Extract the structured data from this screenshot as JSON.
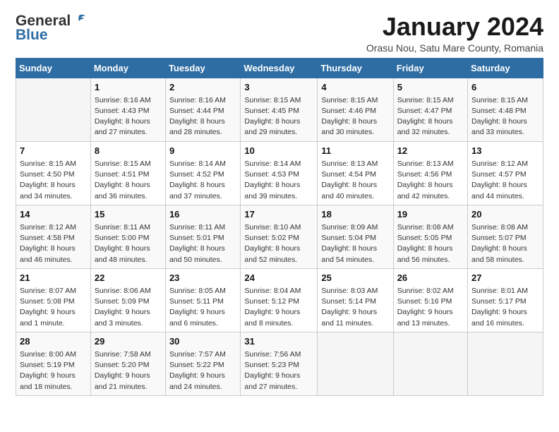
{
  "header": {
    "logo_general": "General",
    "logo_blue": "Blue",
    "title": "January 2024",
    "subtitle": "Orasu Nou, Satu Mare County, Romania"
  },
  "days_of_week": [
    "Sunday",
    "Monday",
    "Tuesday",
    "Wednesday",
    "Thursday",
    "Friday",
    "Saturday"
  ],
  "weeks": [
    [
      {
        "day": "",
        "sunrise": "",
        "sunset": "",
        "daylight": ""
      },
      {
        "day": "1",
        "sunrise": "Sunrise: 8:16 AM",
        "sunset": "Sunset: 4:43 PM",
        "daylight": "Daylight: 8 hours and 27 minutes."
      },
      {
        "day": "2",
        "sunrise": "Sunrise: 8:16 AM",
        "sunset": "Sunset: 4:44 PM",
        "daylight": "Daylight: 8 hours and 28 minutes."
      },
      {
        "day": "3",
        "sunrise": "Sunrise: 8:15 AM",
        "sunset": "Sunset: 4:45 PM",
        "daylight": "Daylight: 8 hours and 29 minutes."
      },
      {
        "day": "4",
        "sunrise": "Sunrise: 8:15 AM",
        "sunset": "Sunset: 4:46 PM",
        "daylight": "Daylight: 8 hours and 30 minutes."
      },
      {
        "day": "5",
        "sunrise": "Sunrise: 8:15 AM",
        "sunset": "Sunset: 4:47 PM",
        "daylight": "Daylight: 8 hours and 32 minutes."
      },
      {
        "day": "6",
        "sunrise": "Sunrise: 8:15 AM",
        "sunset": "Sunset: 4:48 PM",
        "daylight": "Daylight: 8 hours and 33 minutes."
      }
    ],
    [
      {
        "day": "7",
        "sunrise": "Sunrise: 8:15 AM",
        "sunset": "Sunset: 4:50 PM",
        "daylight": "Daylight: 8 hours and 34 minutes."
      },
      {
        "day": "8",
        "sunrise": "Sunrise: 8:15 AM",
        "sunset": "Sunset: 4:51 PM",
        "daylight": "Daylight: 8 hours and 36 minutes."
      },
      {
        "day": "9",
        "sunrise": "Sunrise: 8:14 AM",
        "sunset": "Sunset: 4:52 PM",
        "daylight": "Daylight: 8 hours and 37 minutes."
      },
      {
        "day": "10",
        "sunrise": "Sunrise: 8:14 AM",
        "sunset": "Sunset: 4:53 PM",
        "daylight": "Daylight: 8 hours and 39 minutes."
      },
      {
        "day": "11",
        "sunrise": "Sunrise: 8:13 AM",
        "sunset": "Sunset: 4:54 PM",
        "daylight": "Daylight: 8 hours and 40 minutes."
      },
      {
        "day": "12",
        "sunrise": "Sunrise: 8:13 AM",
        "sunset": "Sunset: 4:56 PM",
        "daylight": "Daylight: 8 hours and 42 minutes."
      },
      {
        "day": "13",
        "sunrise": "Sunrise: 8:12 AM",
        "sunset": "Sunset: 4:57 PM",
        "daylight": "Daylight: 8 hours and 44 minutes."
      }
    ],
    [
      {
        "day": "14",
        "sunrise": "Sunrise: 8:12 AM",
        "sunset": "Sunset: 4:58 PM",
        "daylight": "Daylight: 8 hours and 46 minutes."
      },
      {
        "day": "15",
        "sunrise": "Sunrise: 8:11 AM",
        "sunset": "Sunset: 5:00 PM",
        "daylight": "Daylight: 8 hours and 48 minutes."
      },
      {
        "day": "16",
        "sunrise": "Sunrise: 8:11 AM",
        "sunset": "Sunset: 5:01 PM",
        "daylight": "Daylight: 8 hours and 50 minutes."
      },
      {
        "day": "17",
        "sunrise": "Sunrise: 8:10 AM",
        "sunset": "Sunset: 5:02 PM",
        "daylight": "Daylight: 8 hours and 52 minutes."
      },
      {
        "day": "18",
        "sunrise": "Sunrise: 8:09 AM",
        "sunset": "Sunset: 5:04 PM",
        "daylight": "Daylight: 8 hours and 54 minutes."
      },
      {
        "day": "19",
        "sunrise": "Sunrise: 8:08 AM",
        "sunset": "Sunset: 5:05 PM",
        "daylight": "Daylight: 8 hours and 56 minutes."
      },
      {
        "day": "20",
        "sunrise": "Sunrise: 8:08 AM",
        "sunset": "Sunset: 5:07 PM",
        "daylight": "Daylight: 8 hours and 58 minutes."
      }
    ],
    [
      {
        "day": "21",
        "sunrise": "Sunrise: 8:07 AM",
        "sunset": "Sunset: 5:08 PM",
        "daylight": "Daylight: 9 hours and 1 minute."
      },
      {
        "day": "22",
        "sunrise": "Sunrise: 8:06 AM",
        "sunset": "Sunset: 5:09 PM",
        "daylight": "Daylight: 9 hours and 3 minutes."
      },
      {
        "day": "23",
        "sunrise": "Sunrise: 8:05 AM",
        "sunset": "Sunset: 5:11 PM",
        "daylight": "Daylight: 9 hours and 6 minutes."
      },
      {
        "day": "24",
        "sunrise": "Sunrise: 8:04 AM",
        "sunset": "Sunset: 5:12 PM",
        "daylight": "Daylight: 9 hours and 8 minutes."
      },
      {
        "day": "25",
        "sunrise": "Sunrise: 8:03 AM",
        "sunset": "Sunset: 5:14 PM",
        "daylight": "Daylight: 9 hours and 11 minutes."
      },
      {
        "day": "26",
        "sunrise": "Sunrise: 8:02 AM",
        "sunset": "Sunset: 5:16 PM",
        "daylight": "Daylight: 9 hours and 13 minutes."
      },
      {
        "day": "27",
        "sunrise": "Sunrise: 8:01 AM",
        "sunset": "Sunset: 5:17 PM",
        "daylight": "Daylight: 9 hours and 16 minutes."
      }
    ],
    [
      {
        "day": "28",
        "sunrise": "Sunrise: 8:00 AM",
        "sunset": "Sunset: 5:19 PM",
        "daylight": "Daylight: 9 hours and 18 minutes."
      },
      {
        "day": "29",
        "sunrise": "Sunrise: 7:58 AM",
        "sunset": "Sunset: 5:20 PM",
        "daylight": "Daylight: 9 hours and 21 minutes."
      },
      {
        "day": "30",
        "sunrise": "Sunrise: 7:57 AM",
        "sunset": "Sunset: 5:22 PM",
        "daylight": "Daylight: 9 hours and 24 minutes."
      },
      {
        "day": "31",
        "sunrise": "Sunrise: 7:56 AM",
        "sunset": "Sunset: 5:23 PM",
        "daylight": "Daylight: 9 hours and 27 minutes."
      },
      {
        "day": "",
        "sunrise": "",
        "sunset": "",
        "daylight": ""
      },
      {
        "day": "",
        "sunrise": "",
        "sunset": "",
        "daylight": ""
      },
      {
        "day": "",
        "sunrise": "",
        "sunset": "",
        "daylight": ""
      }
    ]
  ]
}
